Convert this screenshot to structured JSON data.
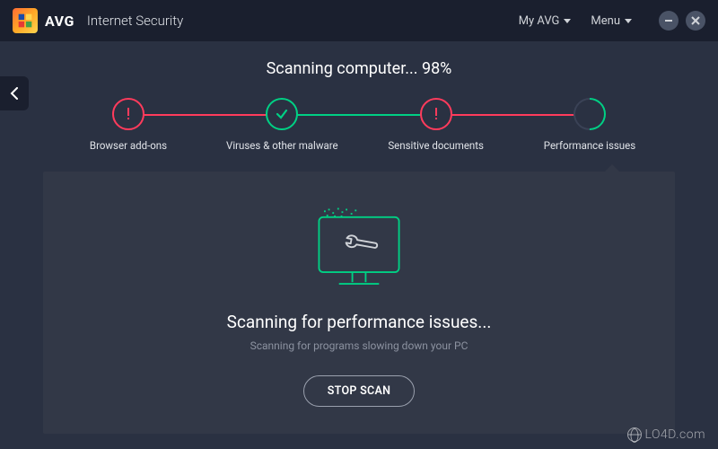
{
  "header": {
    "brand": "AVG",
    "product": "Internet Security",
    "my_avg_label": "My AVG",
    "menu_label": "Menu"
  },
  "scan": {
    "title_prefix": "Scanning computer... ",
    "percent": "98%",
    "stages": [
      {
        "label": "Browser add-ons",
        "status": "alert"
      },
      {
        "label": "Viruses & other malware",
        "status": "ok"
      },
      {
        "label": "Sensitive documents",
        "status": "alert"
      },
      {
        "label": "Performance issues",
        "status": "in_progress"
      }
    ]
  },
  "card": {
    "heading": "Scanning for performance issues...",
    "sub": "Scanning for programs slowing down your PC",
    "stop_label": "STOP SCAN"
  },
  "watermark": "LO4D.com",
  "colors": {
    "accent_green": "#00d084",
    "accent_red": "#ff3b5c",
    "bg": "#2a3142",
    "panel": "#323847",
    "header": "#1a1f2e"
  }
}
